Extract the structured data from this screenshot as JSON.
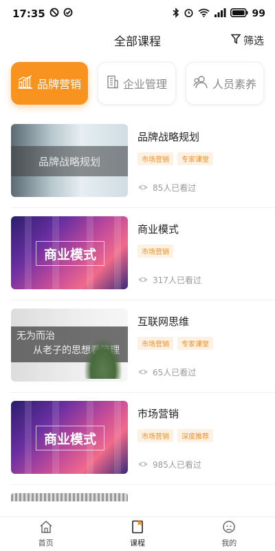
{
  "status": {
    "time": "17:35",
    "battery": "99"
  },
  "header": {
    "title": "全部课程",
    "filter_label": "筛选"
  },
  "categories": [
    {
      "label": "品牌营销",
      "icon": "chart-icon",
      "active": true
    },
    {
      "label": "企业管理",
      "icon": "building-icon",
      "active": false
    },
    {
      "label": "人员素养",
      "icon": "people-icon",
      "active": false
    }
  ],
  "courses": [
    {
      "title": "品牌战略规划",
      "thumb_text": "品牌战略规划",
      "tags": [
        "市场营销",
        "专家课堂"
      ],
      "views": "85人已看过"
    },
    {
      "title": "商业模式",
      "thumb_text": "商业模式",
      "tags": [
        "市场营销"
      ],
      "views": "317人已看过"
    },
    {
      "title": "互联网思维",
      "thumb_line1": "无为而治",
      "thumb_line2": "从老子的思想看管理",
      "tags": [
        "市场营销",
        "专家课堂"
      ],
      "views": "65人已看过"
    },
    {
      "title": "市场营销",
      "thumb_text": "商业模式",
      "tags": [
        "市场营销",
        "深度推荐"
      ],
      "views": "985人已看过"
    }
  ],
  "tabbar": [
    {
      "label": "首页",
      "icon": "home-icon"
    },
    {
      "label": "课程",
      "icon": "book-icon",
      "active": true
    },
    {
      "label": "我的",
      "icon": "profile-icon"
    }
  ],
  "colors": {
    "accent": "#f7931e",
    "tag_text": "#e8912d",
    "tag_bg": "#fdf1e4"
  }
}
